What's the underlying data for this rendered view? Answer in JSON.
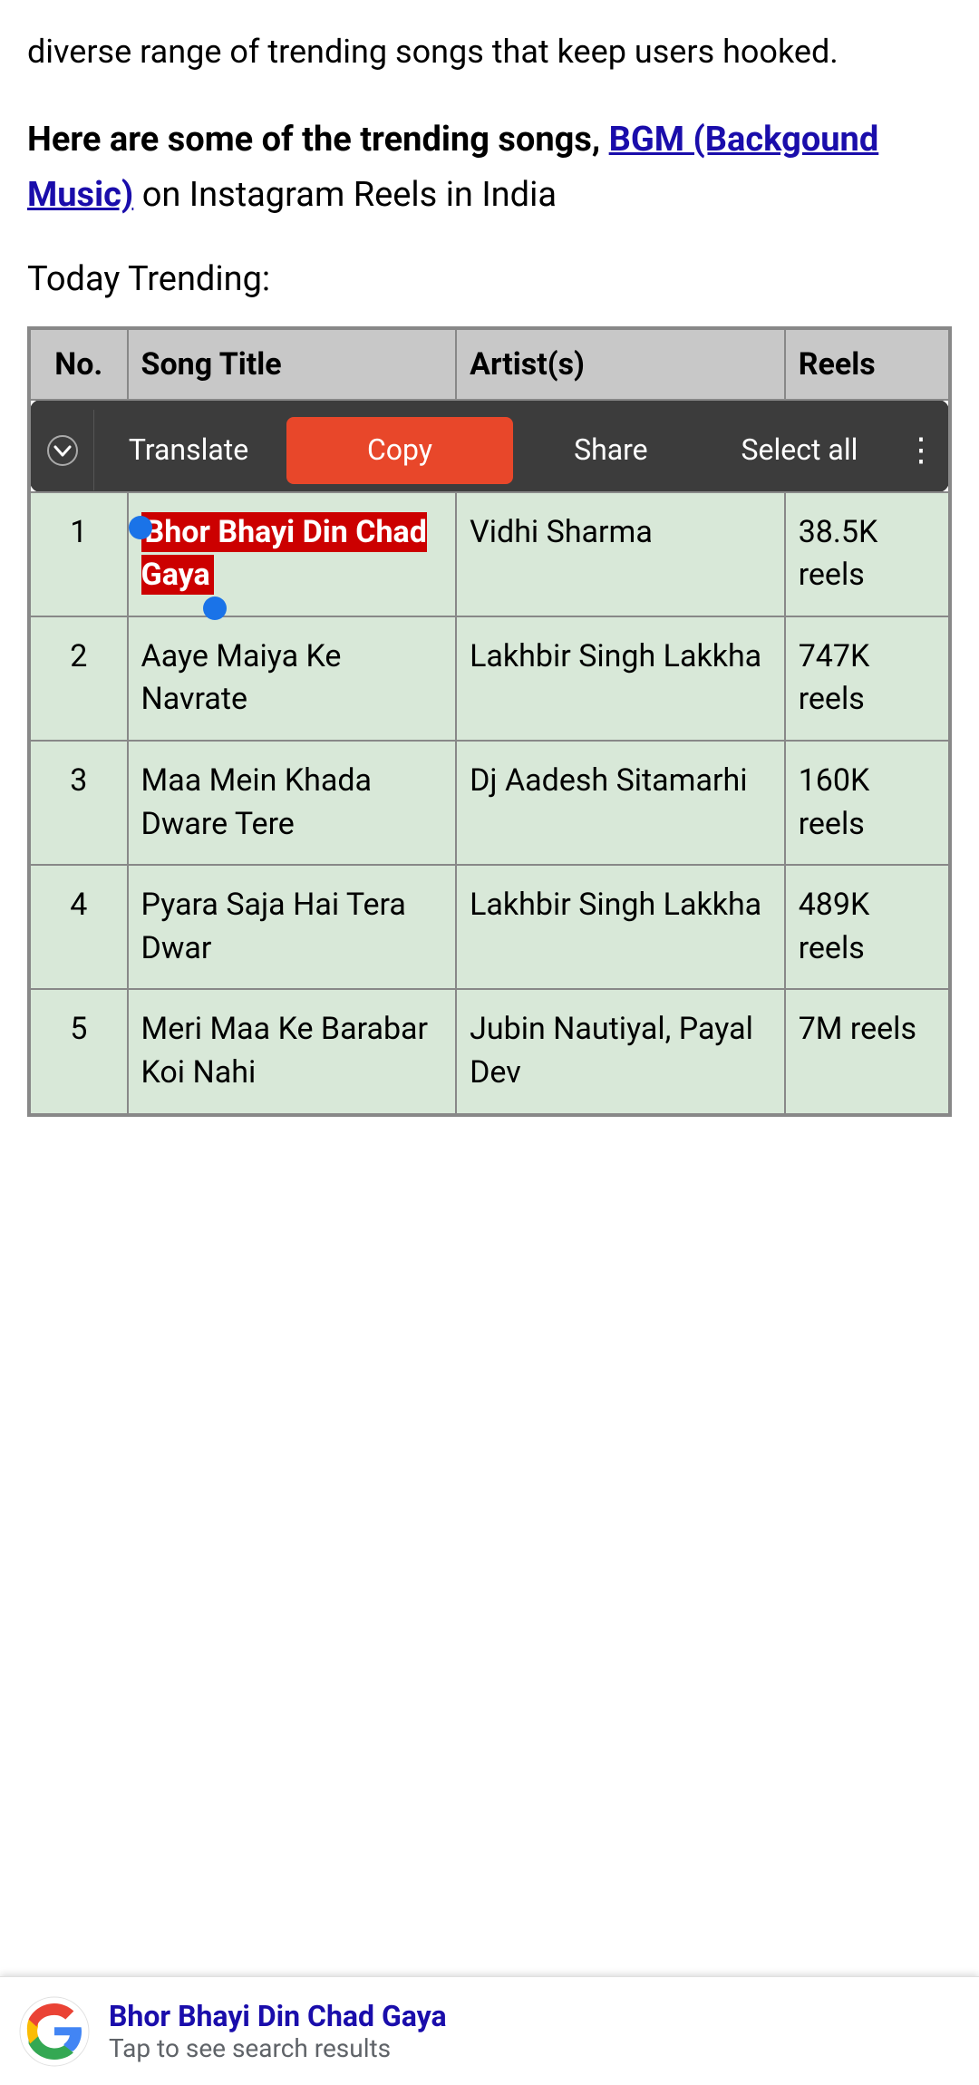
{
  "intro": {
    "text": "diverse range of trending songs that keep users hooked."
  },
  "trending_intro": {
    "prefix": "Here are some of the trending songs, ",
    "link_text": "BGM (Backgound Music)",
    "link_url": "#",
    "suffix": " on Instagram Reels in India"
  },
  "today_trending": {
    "label": "Today Trending:"
  },
  "toolbar": {
    "translate_label": "Translate",
    "copy_label": "Copy",
    "share_label": "Share",
    "select_all_label": "Select all",
    "more_icon": "⋮",
    "chevron_icon": "⌄"
  },
  "table": {
    "headers": {
      "no": "No.",
      "song_title": "Song Title",
      "artists": "Artist(s)",
      "reels": "Reels"
    },
    "rows": [
      {
        "no": "1",
        "song_title": "Bhor Bhayi Din Chad Gaya",
        "artists": "Vidhi Sharma",
        "reels": "38.5K reels",
        "highlighted": true
      },
      {
        "no": "2",
        "song_title": "Aaye Maiya Ke Navrate",
        "artists": "Lakhbir Singh Lakkha",
        "reels": "747K reels",
        "highlighted": false
      },
      {
        "no": "3",
        "song_title": "Maa Mein Khada Dware Tere",
        "artists": "Dj Aadesh Sitamarhi",
        "reels": "160K reels",
        "highlighted": false
      },
      {
        "no": "4",
        "song_title": "Pyara Saja Hai Tera Dwar",
        "artists": "Lakhbir Singh Lakkha",
        "reels": "489K reels",
        "highlighted": false
      },
      {
        "no": "5",
        "song_title": "Meri Maa Ke Barabar Koi Nahi",
        "artists": "Jubin Nautiyal, Payal Dev",
        "reels": "7M reels",
        "highlighted": false
      }
    ]
  },
  "google_search": {
    "title": "Bhor Bhayi Din Chad Gaya",
    "subtitle": "Tap to see search results"
  }
}
